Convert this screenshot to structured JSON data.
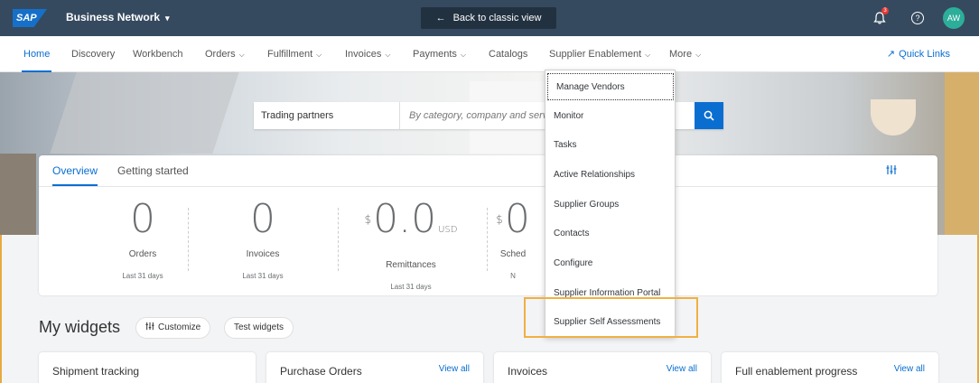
{
  "shell": {
    "logo": "SAP",
    "product": "Business Network",
    "product_caret": "▾",
    "back_arrow": "←",
    "back_label": "Back to classic view",
    "notification_count": "3",
    "help_icon": "?",
    "avatar_initials": "AW"
  },
  "nav": {
    "items": [
      {
        "label": "Home",
        "chevron": ""
      },
      {
        "label": "Discovery",
        "chevron": ""
      },
      {
        "label": "Workbench",
        "chevron": ""
      },
      {
        "label": "Orders",
        "chevron": "⌵"
      },
      {
        "label": "Fulfillment",
        "chevron": "⌵"
      },
      {
        "label": "Invoices",
        "chevron": "⌵"
      },
      {
        "label": "Payments",
        "chevron": "⌵"
      },
      {
        "label": "Catalogs",
        "chevron": ""
      },
      {
        "label": "Supplier Enablement",
        "chevron": "⌵"
      },
      {
        "label": "More",
        "chevron": "⌵"
      }
    ],
    "quick_links": "Quick Links",
    "quick_links_arrow": "↗"
  },
  "search": {
    "scope": "Trading partners",
    "placeholder": "By category, company and service",
    "button_icon": "search-icon"
  },
  "overview": {
    "tabs": [
      "Overview",
      "Getting started"
    ],
    "stats": [
      {
        "currency": "",
        "value": "0",
        "unit": "",
        "label": "Orders",
        "period": "Last 31 days"
      },
      {
        "currency": "",
        "value": "0",
        "unit": "",
        "label": "Invoices",
        "period": "Last 31 days"
      },
      {
        "currency": "$",
        "value": "0.0",
        "unit": "USD",
        "label": "Remittances",
        "period": "Last 31 days"
      },
      {
        "currency": "$",
        "value": "0",
        "unit": "",
        "label": "Sched",
        "period": "N"
      }
    ]
  },
  "widgets": {
    "title": "My widgets",
    "customize": "Customize",
    "test_widgets": "Test widgets",
    "cards": [
      {
        "title": "Shipment tracking",
        "link": ""
      },
      {
        "title": "Purchase Orders",
        "link": "View all"
      },
      {
        "title": "Invoices",
        "link": "View all"
      },
      {
        "title": "Full enablement progress",
        "link": "View all"
      }
    ]
  },
  "dropdown": {
    "items": [
      "Manage Vendors",
      "Monitor",
      "Tasks",
      "Active Relationships",
      "Supplier Groups",
      "Contacts",
      "Configure",
      "Supplier Information Portal",
      "Supplier Self Assessments"
    ],
    "highlighted": "Supplier Self Assessments"
  },
  "colors": {
    "shell": "#354a5f",
    "accent": "#0a6ed1",
    "highlight": "#f0b042"
  }
}
